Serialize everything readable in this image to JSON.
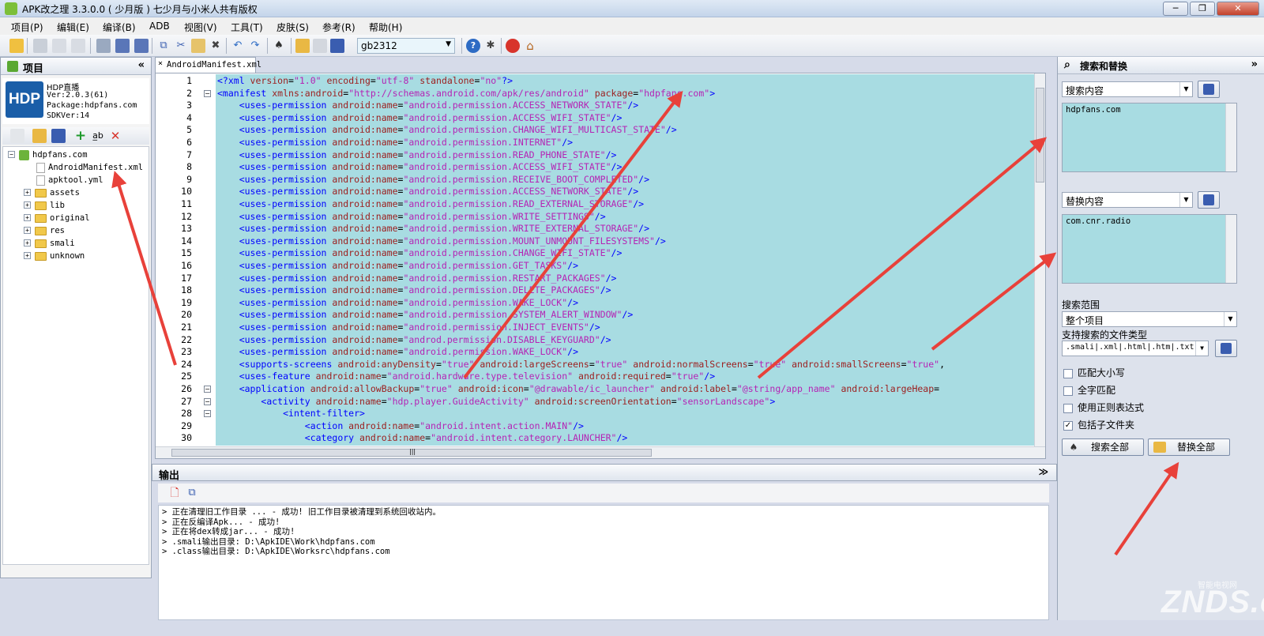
{
  "window": {
    "title": "APK改之理 3.3.0.0 ( 少月版 )  七少月与小米人共有版权",
    "min_label": "─",
    "max_label": "❐",
    "close_label": "✕"
  },
  "menu": [
    "项目(P)",
    "编辑(E)",
    "编译(B)",
    "ADB",
    "视图(V)",
    "工具(T)",
    "皮肤(S)",
    "参考(R)",
    "帮助(H)"
  ],
  "toolbar": {
    "encoding": "gb2312"
  },
  "left_panel": {
    "title": "项目",
    "collapse": "«",
    "logo": "HDP",
    "project_lines": [
      "HDP直播",
      "Ver:2.0.3(61)",
      "Package:hdpfans.com",
      "SDKVer:14"
    ],
    "tree": [
      {
        "label": "hdpfans.com",
        "kind": "project"
      },
      {
        "label": "AndroidManifest.xml",
        "kind": "file"
      },
      {
        "label": "apktool.yml",
        "kind": "file"
      },
      {
        "label": "assets",
        "kind": "folder"
      },
      {
        "label": "lib",
        "kind": "folder"
      },
      {
        "label": "original",
        "kind": "folder"
      },
      {
        "label": "res",
        "kind": "folder"
      },
      {
        "label": "smali",
        "kind": "folder"
      },
      {
        "label": "unknown",
        "kind": "folder"
      }
    ]
  },
  "editor": {
    "tab": "AndroidManifest.xml",
    "tab_close": "×",
    "lines": [
      [
        [
          "tg",
          "<?xml "
        ],
        [
          "at",
          "version"
        ],
        [
          "pl",
          "="
        ],
        [
          "av",
          "\"1.0\""
        ],
        [
          "pl",
          " "
        ],
        [
          "at",
          "encoding"
        ],
        [
          "pl",
          "="
        ],
        [
          "av",
          "\"utf-8\""
        ],
        [
          "pl",
          " "
        ],
        [
          "at",
          "standalone"
        ],
        [
          "pl",
          "="
        ],
        [
          "av",
          "\"no\""
        ],
        [
          "tg",
          "?>"
        ]
      ],
      [
        [
          "tg",
          "<manifest "
        ],
        [
          "at",
          "xmlns:android"
        ],
        [
          "pl",
          "="
        ],
        [
          "av",
          "\"http://schemas.android.com/apk/res/android\""
        ],
        [
          "pl",
          " "
        ],
        [
          "at",
          "package"
        ],
        [
          "pl",
          "="
        ],
        [
          "av",
          "\"hdpfans.com\""
        ],
        [
          "tg",
          ">"
        ]
      ],
      [
        [
          "pl",
          "    "
        ],
        [
          "tg",
          "<uses-permission "
        ],
        [
          "at",
          "android:name"
        ],
        [
          "pl",
          "="
        ],
        [
          "av",
          "\"android.permission.ACCESS_NETWORK_STATE\""
        ],
        [
          "tg",
          "/>"
        ]
      ],
      [
        [
          "pl",
          "    "
        ],
        [
          "tg",
          "<uses-permission "
        ],
        [
          "at",
          "android:name"
        ],
        [
          "pl",
          "="
        ],
        [
          "av",
          "\"android.permission.ACCESS_WIFI_STATE\""
        ],
        [
          "tg",
          "/>"
        ]
      ],
      [
        [
          "pl",
          "    "
        ],
        [
          "tg",
          "<uses-permission "
        ],
        [
          "at",
          "android:name"
        ],
        [
          "pl",
          "="
        ],
        [
          "av",
          "\"android.permission.CHANGE_WIFI_MULTICAST_STATE\""
        ],
        [
          "tg",
          "/>"
        ]
      ],
      [
        [
          "pl",
          "    "
        ],
        [
          "tg",
          "<uses-permission "
        ],
        [
          "at",
          "android:name"
        ],
        [
          "pl",
          "="
        ],
        [
          "av",
          "\"android.permission.INTERNET\""
        ],
        [
          "tg",
          "/>"
        ]
      ],
      [
        [
          "pl",
          "    "
        ],
        [
          "tg",
          "<uses-permission "
        ],
        [
          "at",
          "android:name"
        ],
        [
          "pl",
          "="
        ],
        [
          "av",
          "\"android.permission.READ_PHONE_STATE\""
        ],
        [
          "tg",
          "/>"
        ]
      ],
      [
        [
          "pl",
          "    "
        ],
        [
          "tg",
          "<uses-permission "
        ],
        [
          "at",
          "android:name"
        ],
        [
          "pl",
          "="
        ],
        [
          "av",
          "\"android.permission.ACCESS_WIFI_STATE\""
        ],
        [
          "tg",
          "/>"
        ]
      ],
      [
        [
          "pl",
          "    "
        ],
        [
          "tg",
          "<uses-permission "
        ],
        [
          "at",
          "android:name"
        ],
        [
          "pl",
          "="
        ],
        [
          "av",
          "\"android.permission.RECEIVE_BOOT_COMPLETED\""
        ],
        [
          "tg",
          "/>"
        ]
      ],
      [
        [
          "pl",
          "    "
        ],
        [
          "tg",
          "<uses-permission "
        ],
        [
          "at",
          "android:name"
        ],
        [
          "pl",
          "="
        ],
        [
          "av",
          "\"android.permission.ACCESS_NETWORK_STATE\""
        ],
        [
          "tg",
          "/>"
        ]
      ],
      [
        [
          "pl",
          "    "
        ],
        [
          "tg",
          "<uses-permission "
        ],
        [
          "at",
          "android:name"
        ],
        [
          "pl",
          "="
        ],
        [
          "av",
          "\"android.permission.READ_EXTERNAL_STORAGE\""
        ],
        [
          "tg",
          "/>"
        ]
      ],
      [
        [
          "pl",
          "    "
        ],
        [
          "tg",
          "<uses-permission "
        ],
        [
          "at",
          "android:name"
        ],
        [
          "pl",
          "="
        ],
        [
          "av",
          "\"android.permission.WRITE_SETTINGS\""
        ],
        [
          "tg",
          "/>"
        ]
      ],
      [
        [
          "pl",
          "    "
        ],
        [
          "tg",
          "<uses-permission "
        ],
        [
          "at",
          "android:name"
        ],
        [
          "pl",
          "="
        ],
        [
          "av",
          "\"android.permission.WRITE_EXTERNAL_STORAGE\""
        ],
        [
          "tg",
          "/>"
        ]
      ],
      [
        [
          "pl",
          "    "
        ],
        [
          "tg",
          "<uses-permission "
        ],
        [
          "at",
          "android:name"
        ],
        [
          "pl",
          "="
        ],
        [
          "av",
          "\"android.permission.MOUNT_UNMOUNT_FILESYSTEMS\""
        ],
        [
          "tg",
          "/>"
        ]
      ],
      [
        [
          "pl",
          "    "
        ],
        [
          "tg",
          "<uses-permission "
        ],
        [
          "at",
          "android:name"
        ],
        [
          "pl",
          "="
        ],
        [
          "av",
          "\"android.permission.CHANGE_WIFI_STATE\""
        ],
        [
          "tg",
          "/>"
        ]
      ],
      [
        [
          "pl",
          "    "
        ],
        [
          "tg",
          "<uses-permission "
        ],
        [
          "at",
          "android:name"
        ],
        [
          "pl",
          "="
        ],
        [
          "av",
          "\"android.permission.GET_TASKS\""
        ],
        [
          "tg",
          "/>"
        ]
      ],
      [
        [
          "pl",
          "    "
        ],
        [
          "tg",
          "<uses-permission "
        ],
        [
          "at",
          "android:name"
        ],
        [
          "pl",
          "="
        ],
        [
          "av",
          "\"android.permission.RESTART_PACKAGES\""
        ],
        [
          "tg",
          "/>"
        ]
      ],
      [
        [
          "pl",
          "    "
        ],
        [
          "tg",
          "<uses-permission "
        ],
        [
          "at",
          "android:name"
        ],
        [
          "pl",
          "="
        ],
        [
          "av",
          "\"android.permission.DELETE_PACKAGES\""
        ],
        [
          "tg",
          "/>"
        ]
      ],
      [
        [
          "pl",
          "    "
        ],
        [
          "tg",
          "<uses-permission "
        ],
        [
          "at",
          "android:name"
        ],
        [
          "pl",
          "="
        ],
        [
          "av",
          "\"android.permission.WAKE_LOCK\""
        ],
        [
          "tg",
          "/>"
        ]
      ],
      [
        [
          "pl",
          "    "
        ],
        [
          "tg",
          "<uses-permission "
        ],
        [
          "at",
          "android:name"
        ],
        [
          "pl",
          "="
        ],
        [
          "av",
          "\"android.permission.SYSTEM_ALERT_WINDOW\""
        ],
        [
          "tg",
          "/>"
        ]
      ],
      [
        [
          "pl",
          "    "
        ],
        [
          "tg",
          "<uses-permission "
        ],
        [
          "at",
          "android:name"
        ],
        [
          "pl",
          "="
        ],
        [
          "av",
          "\"android.permission.INJECT_EVENTS\""
        ],
        [
          "tg",
          "/>"
        ]
      ],
      [
        [
          "pl",
          "    "
        ],
        [
          "tg",
          "<uses-permission "
        ],
        [
          "at",
          "android:name"
        ],
        [
          "pl",
          "="
        ],
        [
          "av",
          "\"androd.permission.DISABLE_KEYGUARD\""
        ],
        [
          "tg",
          "/>"
        ]
      ],
      [
        [
          "pl",
          "    "
        ],
        [
          "tg",
          "<uses-permission "
        ],
        [
          "at",
          "android:name"
        ],
        [
          "pl",
          "="
        ],
        [
          "av",
          "\"android.permission.WAKE_LOCK\""
        ],
        [
          "tg",
          "/>"
        ]
      ],
      [
        [
          "pl",
          "    "
        ],
        [
          "tg",
          "<supports-screens "
        ],
        [
          "at",
          "android:anyDensity"
        ],
        [
          "pl",
          "="
        ],
        [
          "av",
          "\"true\""
        ],
        [
          "pl",
          " "
        ],
        [
          "at",
          "android:largeScreens"
        ],
        [
          "pl",
          "="
        ],
        [
          "av",
          "\"true\""
        ],
        [
          "pl",
          " "
        ],
        [
          "at",
          "android:normalScreens"
        ],
        [
          "pl",
          "="
        ],
        [
          "av",
          "\"true\""
        ],
        [
          "pl",
          " "
        ],
        [
          "at",
          "android:smallScreens"
        ],
        [
          "pl",
          "="
        ],
        [
          "av",
          "\"true\""
        ],
        [
          "pl",
          ","
        ]
      ],
      [
        [
          "pl",
          "    "
        ],
        [
          "tg",
          "<uses-feature "
        ],
        [
          "at",
          "android:name"
        ],
        [
          "pl",
          "="
        ],
        [
          "av",
          "\"android.hardware.type.television\""
        ],
        [
          "pl",
          " "
        ],
        [
          "at",
          "android:required"
        ],
        [
          "pl",
          "="
        ],
        [
          "av",
          "\"true\""
        ],
        [
          "tg",
          "/>"
        ]
      ],
      [
        [
          "pl",
          "    "
        ],
        [
          "tg",
          "<application "
        ],
        [
          "at",
          "android:allowBackup"
        ],
        [
          "pl",
          "="
        ],
        [
          "av",
          "\"true\""
        ],
        [
          "pl",
          " "
        ],
        [
          "at",
          "android:icon"
        ],
        [
          "pl",
          "="
        ],
        [
          "av",
          "\"@drawable/ic_launcher\""
        ],
        [
          "pl",
          " "
        ],
        [
          "at",
          "android:label"
        ],
        [
          "pl",
          "="
        ],
        [
          "av",
          "\"@string/app_name\""
        ],
        [
          "pl",
          " "
        ],
        [
          "at",
          "android:largeHeap"
        ],
        [
          "pl",
          "="
        ]
      ],
      [
        [
          "pl",
          "        "
        ],
        [
          "tg",
          "<activity "
        ],
        [
          "at",
          "android:name"
        ],
        [
          "pl",
          "="
        ],
        [
          "av",
          "\"hdp.player.GuideActivity\""
        ],
        [
          "pl",
          " "
        ],
        [
          "at",
          "android:screenOrientation"
        ],
        [
          "pl",
          "="
        ],
        [
          "av",
          "\"sensorLandscape\""
        ],
        [
          "tg",
          ">"
        ]
      ],
      [
        [
          "pl",
          "            "
        ],
        [
          "tg",
          "<intent-filter>"
        ]
      ],
      [
        [
          "pl",
          "                "
        ],
        [
          "tg",
          "<action "
        ],
        [
          "at",
          "android:name"
        ],
        [
          "pl",
          "="
        ],
        [
          "av",
          "\"android.intent.action.MAIN\""
        ],
        [
          "tg",
          "/>"
        ]
      ],
      [
        [
          "pl",
          "                "
        ],
        [
          "tg",
          "<category "
        ],
        [
          "at",
          "android:name"
        ],
        [
          "pl",
          "="
        ],
        [
          "av",
          "\"android.intent.category.LAUNCHER\""
        ],
        [
          "tg",
          "/>"
        ]
      ]
    ],
    "folds": [
      2,
      26,
      27,
      28
    ],
    "hscroll_grip": "|||"
  },
  "output": {
    "title": "输出",
    "collapse": "≫",
    "lines": [
      "> 正在清理旧工作目录 ... - 成功! 旧工作目录被清理到系统回收站内。",
      "> 正在反编译Apk... - 成功!",
      "> 正在将dex转成jar... - 成功!",
      "> .smali输出目录: D:\\ApkIDE\\Work\\hdpfans.com",
      "> .class输出目录: D:\\ApkIDE\\Worksrc\\hdpfans.com"
    ]
  },
  "search_panel": {
    "title": "搜索和替换",
    "collapse": "»",
    "search_label": "搜索内容",
    "search_value": "hdpfans.com",
    "replace_label": "替换内容",
    "replace_value": "com.cnr.radio",
    "scope_label": "搜索范围",
    "scope_value": "整个项目",
    "filetypes_label": "支持搜索的文件类型",
    "filetypes_value": ".smali|.xml|.html|.htm|.txt",
    "options": [
      {
        "label": "匹配大小写",
        "checked": false
      },
      {
        "label": "全字匹配",
        "checked": false
      },
      {
        "label": "使用正则表达式",
        "checked": false
      },
      {
        "label": "包括子文件夹",
        "checked": true
      }
    ],
    "search_all": "搜索全部",
    "replace_all": "替换全部"
  },
  "watermark": {
    "text": "ZNDS.com",
    "sub": "智能电视网"
  },
  "colors": {
    "code_bg": "#a8dce2",
    "tag": "#0000ff",
    "attr": "#9c1d1d",
    "value": "#b524b5",
    "arrow": "#e8413a"
  }
}
